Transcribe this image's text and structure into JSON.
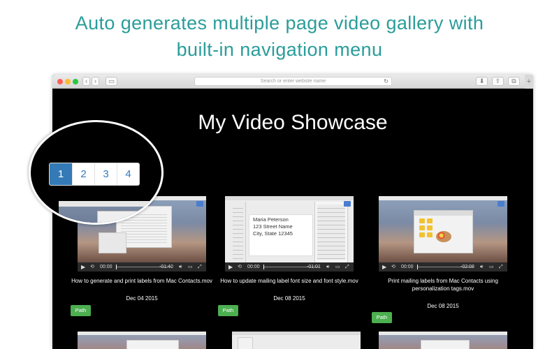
{
  "headline": {
    "line1": "Auto generates multiple page video gallery with",
    "line2": "built-in navigation menu"
  },
  "browser": {
    "address_placeholder": "Search or enter website name",
    "icons": [
      "close-icon",
      "minimize-icon",
      "zoom-icon",
      "back-icon",
      "forward-icon",
      "sidebar-icon",
      "reload-icon",
      "download-icon",
      "share-icon",
      "tabs-icon",
      "new-tab-icon"
    ]
  },
  "page": {
    "title": "My Video Showcase"
  },
  "pagination": {
    "pages": [
      "1",
      "2",
      "3",
      "4"
    ],
    "active": "1"
  },
  "thumb_overlays": {
    "address_card": {
      "line1": "Maria Peterson",
      "line2": "123 Street Name",
      "line3": "City, State 12345"
    }
  },
  "videos": [
    {
      "title": "How to generate and print labels from Mac Contacts.mov",
      "date": "Dec 04 2015",
      "current_time": "00:00",
      "remaining_time": "-01:40",
      "path_label": "Path"
    },
    {
      "title": "How to update mailing label font size and font style.mov",
      "date": "Dec 08 2015",
      "current_time": "00:00",
      "remaining_time": "-01:01",
      "path_label": "Path"
    },
    {
      "title": "Print mailing labels from Mac Contacts using personalization tags.mov",
      "date": "Dec 08 2015",
      "current_time": "00:00",
      "remaining_time": "-02:08",
      "path_label": "Path"
    }
  ],
  "colors": {
    "headline": "#2a9d9a",
    "page_background": "#000000",
    "pagination_active": "#337ab7",
    "path_button": "#4caf50"
  }
}
